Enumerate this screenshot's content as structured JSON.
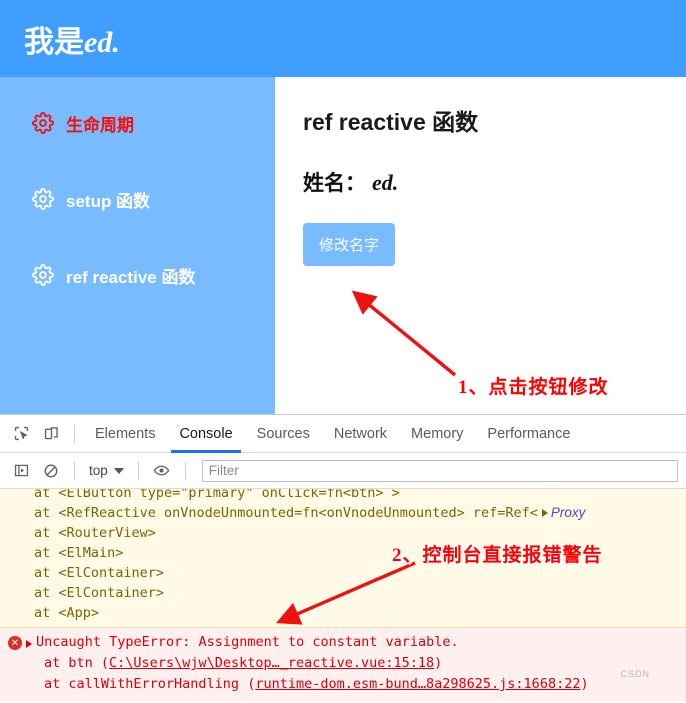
{
  "app": {
    "header": {
      "prefix": "我是",
      "name": "ed."
    },
    "sidebar": {
      "items": [
        {
          "label": "生命周期",
          "icon": "gear-icon",
          "active": true
        },
        {
          "label": "setup 函数",
          "icon": "gear-icon",
          "active": false
        },
        {
          "label": "ref reactive 函数",
          "icon": "gear-icon",
          "active": false
        }
      ]
    },
    "main": {
      "heading": "ref reactive 函数",
      "name_label": "姓名：",
      "name_value": "ed.",
      "button_label": "修改名字"
    },
    "colors": {
      "header_blue": "#409eff",
      "sidebar_blue": "#79bbff",
      "active_red": "#f40f0f",
      "annotation_red": "#ff0000"
    }
  },
  "annotations": {
    "one": "1、点击按钮修改",
    "two": "2、控制台直接报错警告"
  },
  "devtools": {
    "toolbar": {
      "inspect_icon": "inspect-element-icon",
      "device_icon": "device-toolbar-icon"
    },
    "tabs": [
      {
        "label": "Elements",
        "active": false
      },
      {
        "label": "Console",
        "active": true
      },
      {
        "label": "Sources",
        "active": false
      },
      {
        "label": "Network",
        "active": false
      },
      {
        "label": "Memory",
        "active": false
      },
      {
        "label": "Performance",
        "active": false
      }
    ],
    "filterbar": {
      "sidebar_toggle_icon": "console-sidebar-icon",
      "clear_icon": "clear-console-icon",
      "context": "top",
      "eye_icon": "live-expression-icon",
      "filter_placeholder": "Filter",
      "filter_value": ""
    },
    "console": {
      "warning": {
        "lines": [
          "at <ElButton type=\"primary\" onClick=fn<btn> >",
          "at <RefReactive onVnodeUnmounted=fn<onVnodeUnmounted> ref=Ref<",
          "at <RouterView>",
          "at <ElMain>",
          "at <ElContainer>",
          "at <ElContainer>",
          "at <App>"
        ],
        "proxy_label": "Proxy"
      },
      "error": {
        "message": "Uncaught TypeError: Assignment to constant variable.",
        "stack": [
          {
            "fn": "at btn",
            "link": "C:\\Users\\wjw\\Desktop…_reactive.vue:15:18"
          },
          {
            "fn": "at callWithErrorHandling",
            "link": "runtime-dom.esm-bund…8a298625.js:1668:22"
          }
        ]
      },
      "watermark": "CSDN"
    }
  }
}
